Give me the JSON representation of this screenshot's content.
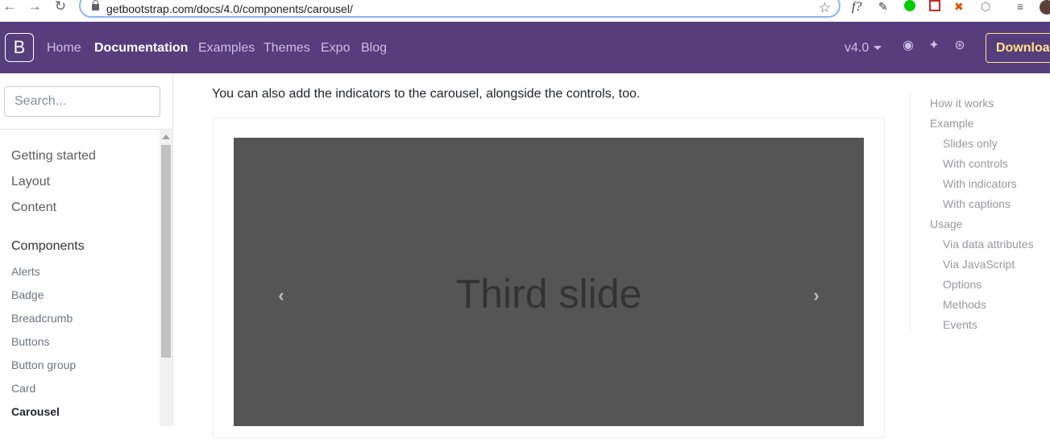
{
  "browser": {
    "url": "getbootstrap.com/docs/4.0/components/carousel/",
    "ext_labels": [
      "f?"
    ]
  },
  "navbar": {
    "brand": "B",
    "links": [
      "Home",
      "Documentation",
      "Examples",
      "Themes",
      "Expo",
      "Blog"
    ],
    "active": "Documentation",
    "version": "v4.0",
    "download": "Download",
    "bg_color": "#563d7c",
    "download_color": "#ffe484"
  },
  "sidebar": {
    "search_placeholder": "Search...",
    "groups": [
      "Getting started",
      "Layout",
      "Content"
    ],
    "components_heading": "Components",
    "component_items": [
      "Alerts",
      "Badge",
      "Breadcrumb",
      "Buttons",
      "Button group",
      "Card",
      "Carousel"
    ],
    "current": "Carousel"
  },
  "main": {
    "lead_text": "You can also add the indicators to the carousel, alongside the controls, too.",
    "slide_text": "Third slide",
    "slide_bg": "#555555"
  },
  "toc": {
    "items": [
      {
        "label": "How it works",
        "level": 1
      },
      {
        "label": "Example",
        "level": 1
      },
      {
        "label": "Slides only",
        "level": 2
      },
      {
        "label": "With controls",
        "level": 2
      },
      {
        "label": "With indicators",
        "level": 2
      },
      {
        "label": "With captions",
        "level": 2
      },
      {
        "label": "Usage",
        "level": 1
      },
      {
        "label": "Via data attributes",
        "level": 2
      },
      {
        "label": "Via JavaScript",
        "level": 2
      },
      {
        "label": "Options",
        "level": 2
      },
      {
        "label": "Methods",
        "level": 2
      },
      {
        "label": "Events",
        "level": 2
      }
    ]
  }
}
